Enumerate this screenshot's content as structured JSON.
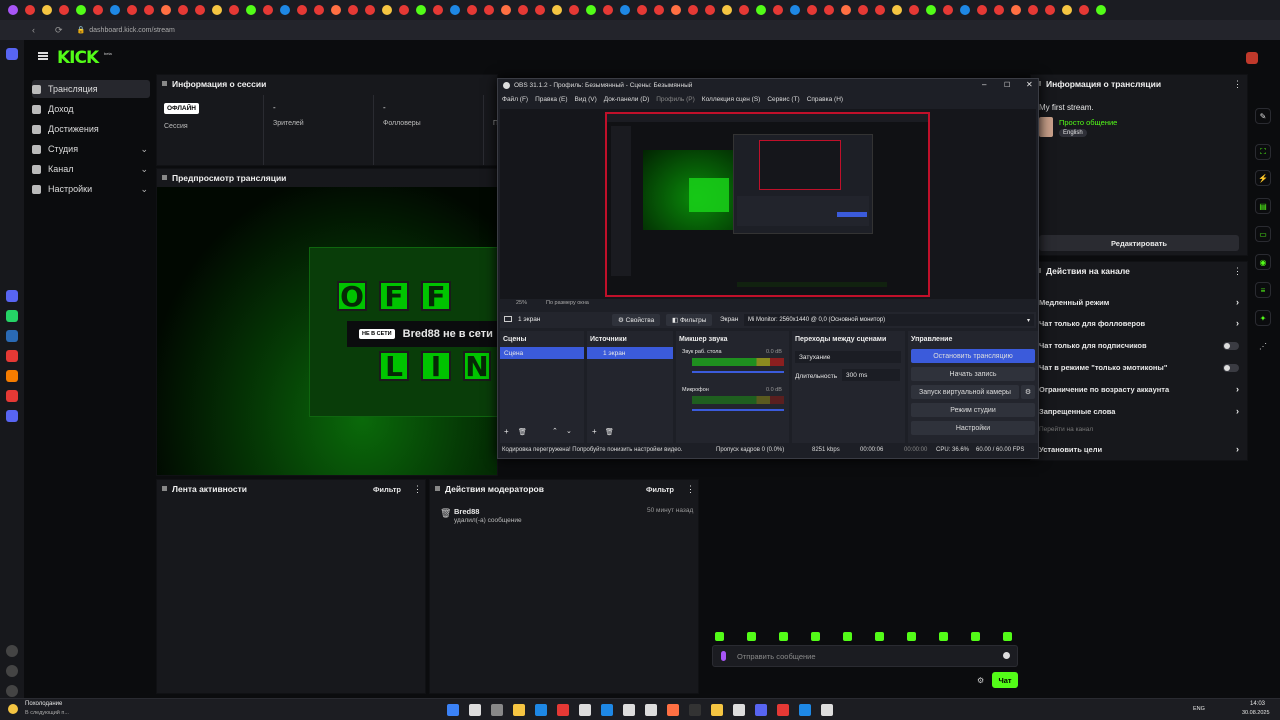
{
  "browser": {
    "url": "dashboard.kick.com/stream"
  },
  "kick": {
    "logo": "KICK",
    "logo_sup": "beta"
  },
  "nav": [
    {
      "label": "Трансляция",
      "active": true
    },
    {
      "label": "Доход"
    },
    {
      "label": "Достижения"
    },
    {
      "label": "Студия",
      "chevron": true
    },
    {
      "label": "Канал",
      "chevron": true
    },
    {
      "label": "Настройки",
      "chevron": true
    }
  ],
  "session": {
    "title": "Информация о сессии",
    "status_badge": "ОФЛАЙН",
    "session_label": "Сессия",
    "viewers_value": "-",
    "viewers_label": "Зрителей",
    "followers_value": "-",
    "followers_label": "Фолловеры",
    "extra_label": "П"
  },
  "preview": {
    "title": "Предпросмотр трансляции",
    "offline_badge": "НЕ В СЕТИ",
    "offline_text": "Bred88 не в сети",
    "letters_top": [
      "O",
      "F",
      "F"
    ],
    "letters_bottom": [
      "L",
      "I",
      "N"
    ]
  },
  "activity": {
    "title": "Лента активности",
    "filter": "Фильтр"
  },
  "moderators": {
    "title": "Действия модераторов",
    "filter": "Фильтр",
    "entry_user": "Bred88",
    "entry_time": "50 минут назад",
    "entry_action": "удалил(-а) сообщение"
  },
  "streaminfo": {
    "title": "Информация о трансляции",
    "stream_title": "My first stream.",
    "category": "Просто общение",
    "language": "English",
    "edit_button": "Редактировать"
  },
  "channel_actions": {
    "title": "Действия на канале",
    "items": [
      {
        "label": "Медленный режим",
        "control": "chevron"
      },
      {
        "label": "Чат только для фолловеров",
        "control": "chevron"
      },
      {
        "label": "Чат только для подписчиков",
        "control": "toggle"
      },
      {
        "label": "Чат в режиме \"только эмотиконы\"",
        "control": "toggle"
      },
      {
        "label": "Ограничение по возрасту аккаунта",
        "control": "chevron"
      },
      {
        "label": "Запрещенные слова",
        "control": "chevron"
      },
      {
        "label": "Перейти на канал",
        "control": "none"
      },
      {
        "label": "Установить цели",
        "control": "chevron"
      }
    ]
  },
  "chat": {
    "placeholder": "Отправить сообщение",
    "send": "Чат"
  },
  "obs": {
    "title": "OBS 31.1.2 - Профиль: Безымянный - Сцены: Безымянный",
    "menu": [
      "Файл (F)",
      "Правка (E)",
      "Вид (V)",
      "Док-панели (D)",
      "Профиль (P)",
      "Коллекция сцен (S)",
      "Сервис (T)",
      "Справка (H)"
    ],
    "zoom": "25%",
    "fit": "По размеру окна",
    "source_bar": {
      "name": "1 экран",
      "props": "Свойства",
      "filters": "Фильтры",
      "screen_label": "Экран",
      "monitor": "Mi Monitor: 2560x1440 @ 0,0 (Основной монитор)"
    },
    "docks": {
      "scenes": "Сцены",
      "sources": "Источники",
      "mixer": "Микшер звука",
      "transitions": "Переходы между сценами",
      "controls": "Управление"
    },
    "scene_item": "Сцена",
    "source_item": "1 экран",
    "mixer": [
      {
        "name": "Звук раб. стола",
        "db": "0.0 dB"
      },
      {
        "name": "Микрофон",
        "db": "0.0 dB"
      }
    ],
    "transition": "Затухание",
    "duration_label": "Длительность",
    "duration": "300 ms",
    "controls": [
      "Остановить трансляцию",
      "Начать запись",
      "Запуск виртуальной камеры",
      "Режим студии",
      "Настройки"
    ],
    "status": {
      "warning": "Кодировка перегружена! Попробуйте понизить настройки видео.",
      "dropped": "Пропуск кадров 0 (0.0%)",
      "kbps": "8251 kbps",
      "stream_time": "00:00:06",
      "rec_time": "00:00:00",
      "cpu": "CPU: 36.6%",
      "fps": "60.00 / 60.00 FPS"
    }
  },
  "taskbar": {
    "weather_title": "Похолодание",
    "weather_sub": "В следующий п...",
    "lang": "ENG",
    "time": "14:03",
    "date": "30.08.2025"
  },
  "colors": {
    "accent": "#53fc18",
    "obs_blue": "#3b5bdb"
  }
}
